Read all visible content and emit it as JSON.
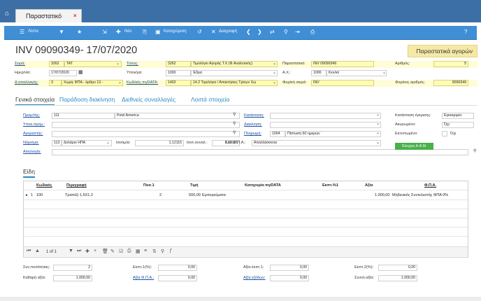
{
  "tab": {
    "title": "Παραστατικό"
  },
  "toolbar": {
    "list": "Λίστα",
    "new": "Νέο",
    "status": "Καταχώριση",
    "delete": "Διαγραφή"
  },
  "header": {
    "doc_title": "INV 09090349- 17/07/2020",
    "badge": "Παραστατικά αγορών"
  },
  "fields": {
    "series_label": "Σειρά:",
    "series_code": "3262",
    "series_name": "TAT",
    "type_label": "Τύπος:",
    "type_code": "3262",
    "type_name": "Τιμολόγιο Αγοράς Τ.Χ (Φ.Αναλυτικός)",
    "doc_label": "Παραστατικό:",
    "doc_value": "INV 09090349",
    "number_label": "Αριθμός:",
    "number_value": "5",
    "date_label": "Ημερ/νία:",
    "date_value": "17/07/2020",
    "branch_label": "Υποκ/μα:",
    "branch_code": "1000",
    "branch_name": "Έδρα",
    "ax_label": "Α.Χ.:",
    "ax_code": "1000",
    "ax_name": "Κεν/κό",
    "vatexempt_label": "Δ.απαλλαγής:",
    "vatexempt_code": "3",
    "vatexempt_name": "Χωρίς ΦΠΑ - άρθρο 13 -",
    "mydata_label": "Κωδ/κός myDATA:",
    "mydata_code": "1402",
    "mydata_name": "14.2 Τιμολόγιο / Αποκτήσεις Τρίτων Χώ",
    "series_tax_label": "Φορ/κή σειρά:",
    "series_tax_value": "INV",
    "tax_no_label": "Φορ/κος αριθμός:",
    "tax_no_value": "9090349"
  },
  "section_tabs": [
    "Γενικά στοιχεία",
    "Παράδοση διακίνηση",
    "Διεθνείς συναλλαγές",
    "Λοιπά στοιχεία"
  ],
  "general": {
    "supplier_label": "Προμ/τής:",
    "supplier_code": "111",
    "supplier_name": "Petzl America",
    "sub_label": "Υποκ.προμ.:",
    "buyer_label": "Αγοραστής:",
    "currency_label": "Νόμισμα:",
    "currency_code": "113",
    "currency_name": "Δολάριο ΗΠΑ",
    "parity_label": "Ισοτιμία:",
    "parity_value": "1,12115",
    "parity2_label": "Ισοτ.συναλ.:",
    "parity2_value": "1,12115",
    "vat_status_label": "Καθ.Φ.Π.Α.:",
    "vat_status_value": "Απαλλάσσεται",
    "reason_label": "Αιτιολογία:",
    "status_label": "Κατάσταση:",
    "transport_label": "Διακίνηση:",
    "payment_label": "Πληρωμή:",
    "payment_code": "1004",
    "payment_name": "Πίστωση 60 ημερών",
    "approval_label": "Κατάσταση έγκρισης:",
    "approval_value": "Εγκεκριμέν",
    "cancel_label": "Ακυρωμένο:",
    "cancel_value": "Όχι",
    "printed_label": "Εκτυπωμένο:",
    "printed_value": "Όχι",
    "check_vat_button": "Έλεγχος Α.Φ.Μ."
  },
  "items": {
    "tab_title": "Είδη",
    "columns": [
      "Κωδικός",
      "Περιγραφή",
      "Ποσ.1",
      "Τιμή",
      "Κατηγορία myDATA",
      "Εκπτ.%1",
      "Αξία",
      "Φ.Π.Α."
    ],
    "rows": [
      {
        "row": "1",
        "code": "100",
        "desc": "Τραπέζι 1,5Χ1.2",
        "qty": "2",
        "price": "500,00",
        "cat": "Εμπορεύματα",
        "disc": "",
        "value": "1.000,00",
        "vat": "Μηδενικός Συντελεστής ΦΠΑ 0%"
      }
    ],
    "pager": "1 of 1"
  },
  "footer": {
    "qty_total_label": "Συν.ποσότητας:",
    "qty_total": "2",
    "net_label": "Καθαρή αξία:",
    "net": "1.000,00",
    "disc1_label": "Εκπτ.1(%):",
    "disc1": "0,00",
    "vat_label": "Αξία Φ.Π.Α.:",
    "vat": "0,00",
    "disc_value_label": "Αξία έκπτ.1:",
    "disc_value": "0,00",
    "expenses_label": "Αξία εξόδων:",
    "expenses": "0,00",
    "disc2_label": "Εκπτ.2(%):",
    "disc2": "0,00",
    "total_label": "Συνολ.αξία:",
    "total": "1.000,00"
  },
  "colors": {
    "titlebar": "#3d6fa7",
    "toolbar": "#3f8ed6",
    "accent": "#2a8ac4",
    "highlight": "#fffcb8",
    "green": "#49b04a"
  }
}
